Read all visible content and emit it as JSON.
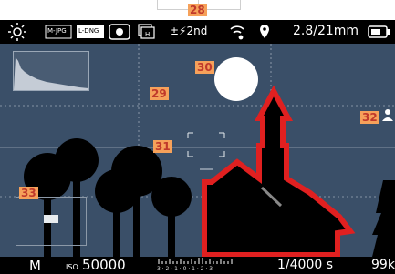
{
  "callouts": {
    "c28": "28",
    "c29": "29",
    "c30": "30",
    "c31": "31",
    "c32": "32",
    "c33": "33"
  },
  "top_status": {
    "icons": [
      "brightness-icon",
      "file-format-mjpg-icon",
      "file-format-ldng-icon",
      "metering-icon",
      "drive-mode-icon",
      "exposure-compensation-flash-icon",
      "wifi-icon",
      "location-icon",
      "battery-icon"
    ],
    "mjpg": "M-JPG",
    "ldng": "L-DNG",
    "flash": "±⚡2nd",
    "lens": "2.8/21mm"
  },
  "bottom_status": {
    "mode": "M",
    "iso_label": "ISO",
    "iso_value": "50000",
    "ev_scale": "3 · 2 · 1 · 0 · 1 · 2 · 3",
    "shutter": "1/4000 s",
    "remaining": "99k"
  },
  "colors": {
    "sky": "#3a4f68",
    "highlight_red": "#e02020",
    "callout_bg": "#f6a15a",
    "callout_text": "#c0392b"
  }
}
